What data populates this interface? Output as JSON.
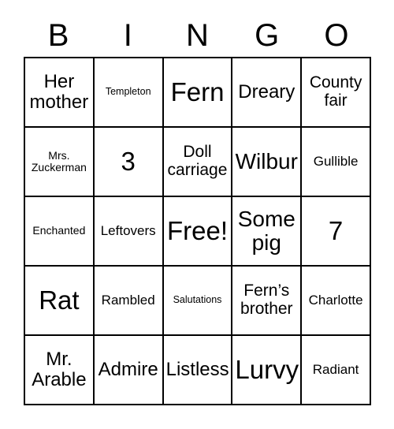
{
  "card": {
    "header_letters": [
      "B",
      "I",
      "N",
      "G",
      "O"
    ],
    "columns": [
      {
        "letter": "B",
        "cells": [
          {
            "text": "Her\nmother",
            "size": "lg"
          },
          {
            "text": "Mrs.\nZuckerman",
            "size": "xs"
          },
          {
            "text": "Enchanted",
            "size": "xs"
          },
          {
            "text": "Rat",
            "size": "xxl"
          },
          {
            "text": "Mr.\nArable",
            "size": "lg"
          }
        ]
      },
      {
        "letter": "I",
        "cells": [
          {
            "text": "Templeton",
            "size": "xxs"
          },
          {
            "text": "3",
            "size": "xxl"
          },
          {
            "text": "Leftovers",
            "size": "sm"
          },
          {
            "text": "Rambled",
            "size": "sm"
          },
          {
            "text": "Admire",
            "size": "lg"
          }
        ]
      },
      {
        "letter": "N",
        "cells": [
          {
            "text": "Fern",
            "size": "xxl"
          },
          {
            "text": "Doll\ncarriage",
            "size": "md"
          },
          {
            "text": "Free!",
            "size": "xxl"
          },
          {
            "text": "Salutations",
            "size": "xxs"
          },
          {
            "text": "Listless",
            "size": "lg"
          }
        ]
      },
      {
        "letter": "G",
        "cells": [
          {
            "text": "Dreary",
            "size": "lg"
          },
          {
            "text": "Wilbur",
            "size": "xl"
          },
          {
            "text": "Some\npig",
            "size": "xl"
          },
          {
            "text": "Fern’s\nbrother",
            "size": "md"
          },
          {
            "text": "Lurvy",
            "size": "xxl"
          }
        ]
      },
      {
        "letter": "O",
        "cells": [
          {
            "text": "County\nfair",
            "size": "md"
          },
          {
            "text": "Gullible",
            "size": "sm"
          },
          {
            "text": "7",
            "size": "xxl"
          },
          {
            "text": "Charlotte",
            "size": "sm"
          },
          {
            "text": "Radiant",
            "size": "sm"
          }
        ]
      }
    ]
  },
  "colors": {
    "background": "#ffffff",
    "text": "#000000",
    "border": "#000000"
  }
}
